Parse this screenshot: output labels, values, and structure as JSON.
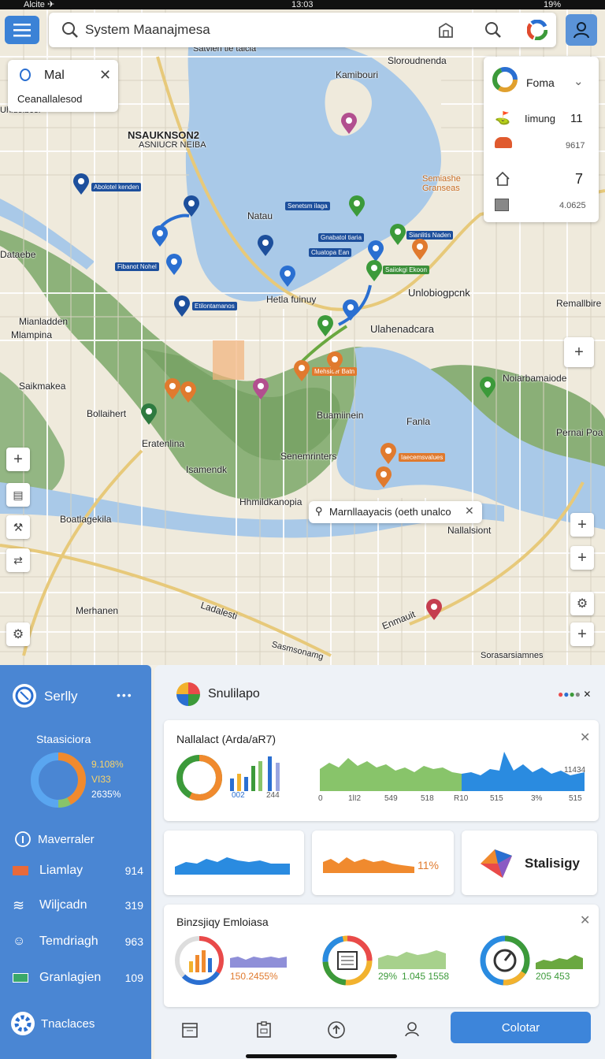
{
  "status": {
    "carrier": "Alcite ✈",
    "time": "13:03",
    "battery": "19%"
  },
  "search": {
    "value": "System Maanajmesa"
  },
  "location_card": {
    "title": "Mal",
    "subtitle": "Ceanallalesod"
  },
  "layer_card": {
    "title": "Foma",
    "rows": [
      {
        "icon": "person-pin-icon",
        "label": "Iimung",
        "value": "11"
      },
      {
        "icon": "hardhat-icon",
        "label": "",
        "value": "9617"
      },
      {
        "icon": "home-icon",
        "label": "",
        "value": "7"
      },
      {
        "icon": "cube-icon",
        "label": "",
        "value": "4.0625"
      }
    ]
  },
  "map": {
    "labels": [
      "Satvien tie talcia",
      "Sloroudnenda",
      "Kamibouri",
      "Uniolbocnel",
      "NSAUKNSON2",
      "ASNIUCR NEIBA",
      "Natau",
      "Semiashe Granseas",
      "Hetla fuinuy",
      "Unlobiogpcnk",
      "Remallbire",
      "Mianladden",
      "Mlampina",
      "Ulahenadcara",
      "Saikmakea",
      "Noiarbamaiode",
      "Bollaihert",
      "Buamiinein",
      "Fanla",
      "Eratenlina",
      "Senemrinters",
      "Isamendk",
      "Boatlagekila",
      "Hhmildkanopia",
      "Nallalsiont",
      "Pernai Poa",
      "Merhanen",
      "Ladalesti",
      "Enmauit",
      "Sasmsonamg",
      "Sorasarsiamnes",
      "Dataebe",
      "Uhidoibcer"
    ],
    "tags": [
      "Abolotel kenden",
      "Senetsm ilaga",
      "Gnabatol tiaria",
      "Sianlitis Naden",
      "Cluatopa Ean",
      "Fibanot Nohel",
      "Saiiokgi Ekoon",
      "Etilontamanos",
      "Mehsicer Batn",
      "Iaecemsvalues"
    ],
    "popup": "Marnllaayacis (oeth unalco"
  },
  "left_panel": {
    "title": "Serlly",
    "donut_title": "Staasiciora",
    "donut_values": [
      "9.108%",
      "VI33",
      "2635%"
    ],
    "section": "Maverraler",
    "rows": [
      {
        "icon": "flag-icon",
        "label": "Liamlay",
        "value": "914"
      },
      {
        "icon": "wind-icon",
        "label": "Wiljcadn",
        "value": "319"
      },
      {
        "icon": "user-icon",
        "label": "Temdriagh",
        "value": "963"
      },
      {
        "icon": "chart-icon",
        "label": "Granlagien",
        "value": "109"
      }
    ],
    "footer": "Tnaclaces"
  },
  "right_panel": {
    "title": "Snulilapo",
    "card1": {
      "title": "Nallalact (Arda/aR7)",
      "bar_labels": [
        "002",
        "244"
      ],
      "area_ticks": [
        "0",
        "1lI2",
        "549",
        "518",
        "R10",
        "515",
        "3%",
        "515"
      ],
      "peak": "11434"
    },
    "card2_value": "11%",
    "card3_label": "Stalisigy",
    "card4": {
      "title": "Binzsjiqy Emloiasa",
      "values": [
        "150.2455%",
        "29%",
        "1.045 1558",
        "205 453"
      ]
    },
    "primary_button": "Colotar"
  },
  "colors": {
    "accent": "#3d85da",
    "panel": "#4a86d3",
    "water": "#a9c9e8",
    "park": "#7fa86a"
  }
}
